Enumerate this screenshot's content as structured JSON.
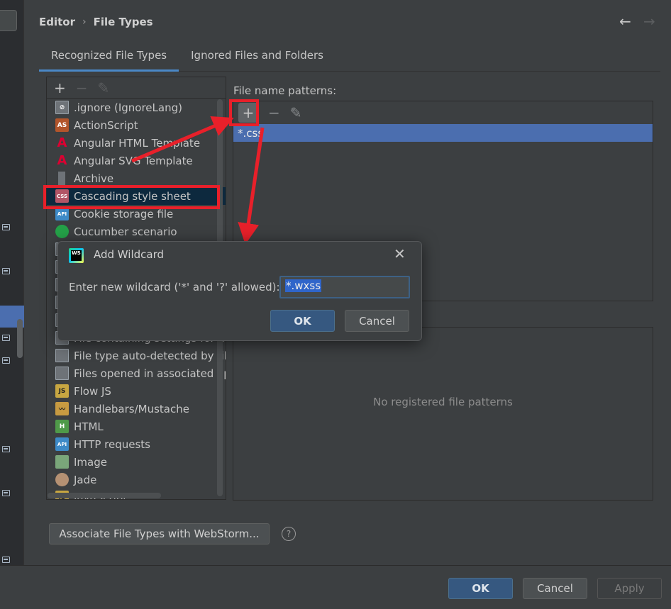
{
  "header": {
    "breadcrumb": [
      "Editor",
      "File Types"
    ],
    "separator": "›",
    "back_icon": "←",
    "forward_icon": "→"
  },
  "tabs": [
    {
      "label": "Recognized File Types",
      "active": true
    },
    {
      "label": "Ignored Files and Folders",
      "active": false
    }
  ],
  "list_toolbar": {
    "add": "+",
    "remove": "−",
    "edit": "✎"
  },
  "file_types": [
    {
      "label": ".ignore (IgnoreLang)",
      "icon": "ignore-file-icon",
      "badge": "⊘"
    },
    {
      "label": "ActionScript",
      "icon": "actionscript-icon",
      "badge": "AS"
    },
    {
      "label": "Angular HTML Template",
      "icon": "angular-icon",
      "badge": "A"
    },
    {
      "label": "Angular SVG Template",
      "icon": "angular-icon",
      "badge": "A"
    },
    {
      "label": "Archive",
      "icon": "archive-icon",
      "badge": ""
    },
    {
      "label": "Cascading style sheet",
      "icon": "css-icon",
      "badge": "CSS",
      "selected": true
    },
    {
      "label": "Cookie storage file",
      "icon": "api-icon",
      "badge": "API"
    },
    {
      "label": "Cucumber scenario",
      "icon": "cucumber-icon",
      "badge": ""
    },
    {
      "label": "",
      "icon": "file-icon",
      "badge": ""
    },
    {
      "label": "",
      "icon": "file-icon",
      "badge": ""
    },
    {
      "label": "",
      "icon": "file-icon",
      "badge": ""
    },
    {
      "label": "",
      "icon": "file-icon",
      "badge": ""
    },
    {
      "label": "",
      "icon": "file-icon",
      "badge": ""
    },
    {
      "label": "File containing settings for ed",
      "icon": "file-icon",
      "badge": ""
    },
    {
      "label": "File type auto-detected by file",
      "icon": "file-icon",
      "badge": ""
    },
    {
      "label": "Files opened in associated app",
      "icon": "file-icon",
      "badge": ""
    },
    {
      "label": "Flow JS",
      "icon": "flow-js-icon",
      "badge": "JS"
    },
    {
      "label": "Handlebars/Mustache",
      "icon": "handlebars-icon",
      "badge": "〰"
    },
    {
      "label": "HTML",
      "icon": "html-icon",
      "badge": "H"
    },
    {
      "label": "HTTP requests",
      "icon": "api-icon",
      "badge": "API"
    },
    {
      "label": "Image",
      "icon": "image-icon",
      "badge": ""
    },
    {
      "label": "Jade",
      "icon": "jade-icon",
      "badge": ""
    },
    {
      "label": "JavaScript",
      "icon": "js-icon",
      "badge": "JS"
    }
  ],
  "patterns": {
    "label": "File name patterns:",
    "toolbar": {
      "add": "+",
      "remove": "−",
      "edit": "✎"
    },
    "items": [
      "*.css"
    ]
  },
  "registered": {
    "empty_text": "No registered file patterns"
  },
  "associate_button": "Associate File Types with WebStorm...",
  "help_icon": "?",
  "footer": {
    "ok": "OK",
    "cancel": "Cancel",
    "apply": "Apply"
  },
  "dialog": {
    "logo_text": "WS",
    "title": "Add Wildcard",
    "close": "✕",
    "label": "Enter new wildcard ('*' and '?' allowed):",
    "value": "*.wxss",
    "ok": "OK",
    "cancel": "Cancel"
  },
  "colors": {
    "background": "#3c3f41",
    "selection": "#4b6eaf",
    "list_selection": "#0d293e",
    "primary_button": "#365880",
    "annotation_red": "#e8202a"
  }
}
